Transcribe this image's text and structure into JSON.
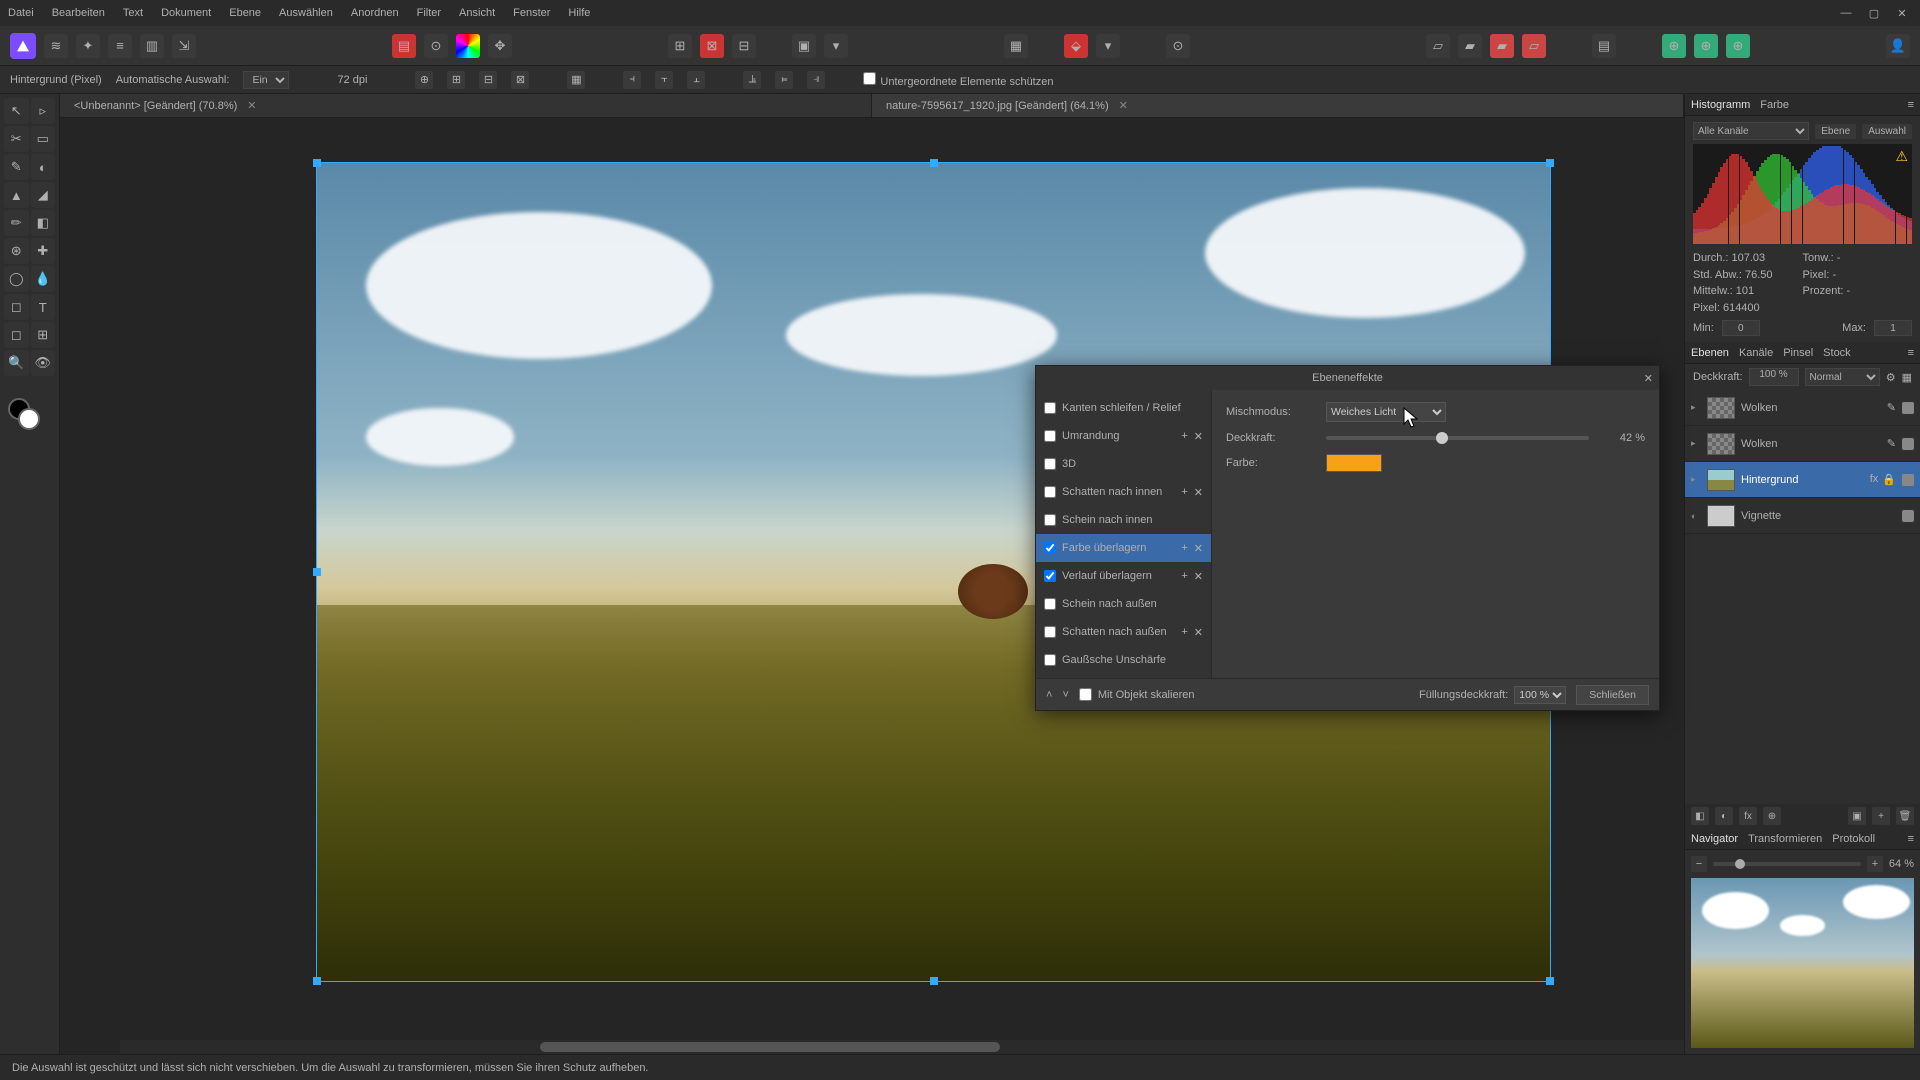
{
  "menu": {
    "items": [
      "Datei",
      "Bearbeiten",
      "Text",
      "Dokument",
      "Ebene",
      "Auswählen",
      "Anordnen",
      "Filter",
      "Ansicht",
      "Fenster",
      "Hilfe"
    ]
  },
  "context": {
    "layer_info": "Hintergrund (Pixel)",
    "mode_label": "Automatische Auswahl:",
    "mode_value": "Ein",
    "dpi": "72 dpi",
    "protect_label": "Untergeordnete Elemente schützen"
  },
  "tabs": [
    {
      "label": "<Unbenannt> [Geändert] (70.8%)",
      "active": false
    },
    {
      "label": "nature-7595617_1920.jpg [Geändert] (64.1%)",
      "active": true
    }
  ],
  "histogram": {
    "tabs": [
      "Histogramm",
      "Farbe"
    ],
    "channel": "Alle Kanäle",
    "btn_layer": "Ebene",
    "btn_selection": "Auswahl",
    "stats": {
      "durch": "Durch.: 107.03",
      "stdabw": "Std. Abw.: 76.50",
      "mittelw": "Mittelw.: 101",
      "pixel": "Pixel: 614400",
      "tonw": "Tonw.: -",
      "pixels2": "Pixel: -",
      "prozent": "Prozent: -"
    },
    "min_label": "Min:",
    "min_val": "0",
    "max_label": "Max:",
    "max_val": "1"
  },
  "layers_panel": {
    "tabs": [
      "Ebenen",
      "Kanäle",
      "Pinsel",
      "Stock"
    ],
    "opacity_label": "Deckkraft:",
    "opacity_value": "100 %",
    "blend_value": "Normal",
    "items": [
      {
        "name": "Wolken",
        "thumb": "checker",
        "expandable": true,
        "selected": false,
        "visible": true
      },
      {
        "name": "Wolken",
        "thumb": "checker",
        "expandable": true,
        "selected": false,
        "visible": true
      },
      {
        "name": "Hintergrund",
        "thumb": "img",
        "expandable": true,
        "selected": true,
        "visible": true,
        "fx": true,
        "lock": true
      },
      {
        "name": "Vignette",
        "thumb": "white",
        "expandable": false,
        "selected": false,
        "visible": true,
        "adjust": true
      }
    ]
  },
  "navigator": {
    "tabs": [
      "Navigator",
      "Transformieren",
      "Protokoll"
    ],
    "zoom": "64 %"
  },
  "fx_dialog": {
    "title": "Ebeneneffekte",
    "effects": [
      {
        "name": "Kanten schleifen / Relief",
        "checked": false,
        "icons": false
      },
      {
        "name": "Umrandung",
        "checked": false,
        "icons": true
      },
      {
        "name": "3D",
        "checked": false,
        "icons": false
      },
      {
        "name": "Schatten nach innen",
        "checked": false,
        "icons": true
      },
      {
        "name": "Schein nach innen",
        "checked": false,
        "icons": false
      },
      {
        "name": "Farbe überlagern",
        "checked": true,
        "icons": true,
        "selected": true
      },
      {
        "name": "Verlauf überlagern",
        "checked": true,
        "icons": true
      },
      {
        "name": "Schein nach außen",
        "checked": false,
        "icons": false
      },
      {
        "name": "Schatten nach außen",
        "checked": false,
        "icons": true
      },
      {
        "name": "Gaußsche Unschärfe",
        "checked": false,
        "icons": false
      }
    ],
    "blend_label": "Mischmodus:",
    "blend_value": "Weiches Licht",
    "opacity_label": "Deckkraft:",
    "opacity_value": "42 %",
    "opacity_pct": 42,
    "color_label": "Farbe:",
    "color_value": "#f7a018",
    "scale_label": "Mit Objekt skalieren",
    "fill_label": "Füllungsdeckkraft:",
    "fill_value": "100 %",
    "close_btn": "Schließen"
  },
  "status": "Die Auswahl ist geschützt und lässt sich nicht verschieben. Um die Auswahl zu transformieren, müssen Sie ihren Schutz aufheben."
}
